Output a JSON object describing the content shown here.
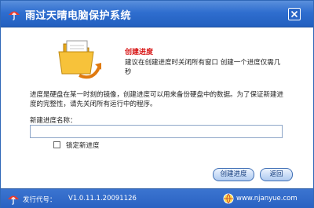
{
  "window": {
    "title": "雨过天晴电脑保护系统",
    "close_glyph": "✕"
  },
  "header": {
    "heading": "创建进度",
    "subtext": "建议在创建进度时关闭所有窗口 创建一个进度仅需几秒"
  },
  "body": {
    "description": "进度是硬盘在某一时刻的镜像，创建进度可以用来备份硬盘中的数据。为了保证新建进度的完整性，请先关闭所有运行中的程序。",
    "name_label": "新建进度名称：",
    "name_value": "",
    "lock_label": "锁定新进度",
    "lock_checked": false
  },
  "buttons": {
    "create_label": "创建进度",
    "back_label": "返回"
  },
  "status": {
    "version_label": "发行代号：",
    "version_value": "V1.0.11.1.20091126",
    "website": "www.njanyue.com"
  },
  "colors": {
    "titlebar": "#2f6ecf",
    "heading": "#d81818",
    "statusbar": "#2a62c2"
  },
  "icons": {
    "app": "umbrella-logo-icon",
    "hero": "snapshot-folder-icon",
    "website": "globe-icon"
  }
}
